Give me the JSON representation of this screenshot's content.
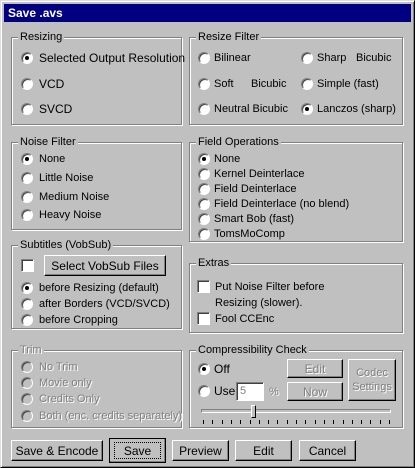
{
  "window": {
    "title": "Save .avs"
  },
  "resizing": {
    "legend": "Resizing",
    "options": [
      "Selected Output Resolution",
      "VCD",
      "SVCD"
    ],
    "selected": 0
  },
  "resize_filter": {
    "legend": "Resize Filter",
    "options": [
      "Bilinear",
      "Sharp",
      "Bicubic",
      "Soft",
      "Bicubic",
      "Simple (fast)",
      "Neutral Bicubic",
      "Lanczos (sharp)"
    ],
    "selected": "Lanczos (sharp)"
  },
  "noise_filter": {
    "legend": "Noise Filter",
    "options": [
      "None",
      "Little Noise",
      "Medium Noise",
      "Heavy Noise"
    ],
    "selected": 0
  },
  "field_operations": {
    "legend": "Field Operations",
    "options": [
      "None",
      "Kernel Deinterlace",
      "Field Deinterlace",
      "Field Deinterlace (no blend)",
      "Smart Bob (fast)",
      "TomsMoComp"
    ],
    "selected": 0
  },
  "subtitles": {
    "legend": "Subtitles (VobSub)",
    "select_button": "Select VobSub Files",
    "options": [
      "before Resizing (default)",
      "after Borders (VCD/SVCD)",
      "before Cropping"
    ],
    "selected": 0
  },
  "extras": {
    "legend": "Extras",
    "noise_before_line1": "Put Noise Filter before",
    "noise_before_line2": "Resizing (slower).",
    "fool_ccenc": "Fool CCEnc"
  },
  "trim": {
    "legend": "Trim",
    "options": [
      "No Trim",
      "Movie only",
      "Credits Only",
      "Both (enc. credits separately)"
    ],
    "selected": 0
  },
  "compressibility": {
    "legend": "Compressibility Check",
    "off_label": "Off",
    "use_label": "Use",
    "use_value": "5",
    "percent": "%",
    "edit_button": "Edit",
    "now_button": "Now",
    "codec_line1": "Codec",
    "codec_line2": "Settings",
    "slider_level": 0.27
  },
  "buttons": {
    "save_encode": "Save & Encode",
    "save": "Save",
    "preview": "Preview",
    "edit": "Edit",
    "cancel": "Cancel"
  }
}
